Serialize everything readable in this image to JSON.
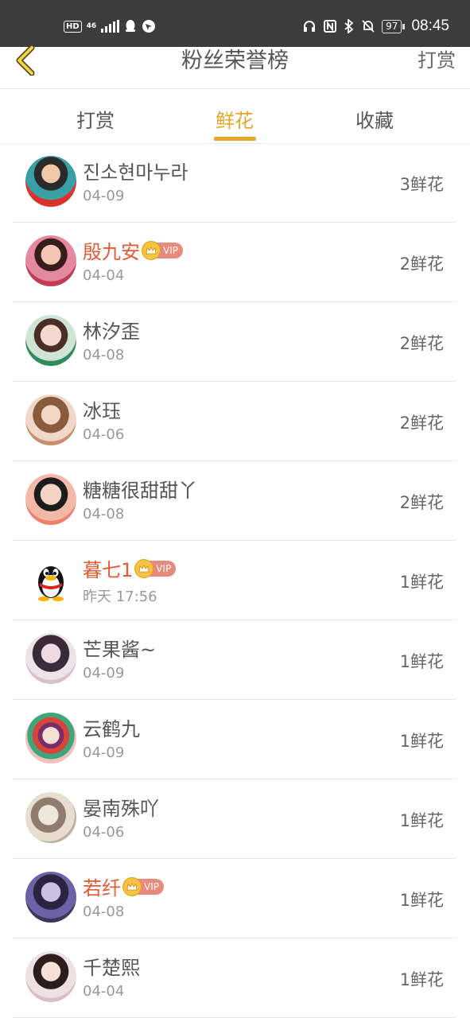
{
  "status_bar": {
    "hd": "HD",
    "network": "46",
    "battery": "97",
    "time": "08:45"
  },
  "header": {
    "title": "粉丝荣誉榜",
    "action": "打赏"
  },
  "tabs": [
    {
      "label": "打赏",
      "active": false
    },
    {
      "label": "鲜花",
      "active": true
    },
    {
      "label": "收藏",
      "active": false
    }
  ],
  "accent_color": "#e9a42c",
  "vip_name_color": "#e25b34",
  "vip_label": "VIP",
  "fans": [
    {
      "name": "진소현마누라",
      "date": "04-09",
      "amount": "3鲜花",
      "vip": false
    },
    {
      "name": "殷九安",
      "date": "04-04",
      "amount": "2鲜花",
      "vip": true
    },
    {
      "name": "林汐歪",
      "date": "04-08",
      "amount": "2鲜花",
      "vip": false
    },
    {
      "name": "冰珏",
      "date": "04-06",
      "amount": "2鲜花",
      "vip": false
    },
    {
      "name": "糖糖很甜甜丫",
      "date": "04-08",
      "amount": "2鲜花",
      "vip": false
    },
    {
      "name": "暮七1",
      "date": "昨天 17:56",
      "amount": "1鲜花",
      "vip": true
    },
    {
      "name": "芒果酱~",
      "date": "04-09",
      "amount": "1鲜花",
      "vip": false
    },
    {
      "name": "云鹤九",
      "date": "04-09",
      "amount": "1鲜花",
      "vip": false
    },
    {
      "name": "晏南殊吖",
      "date": "04-06",
      "amount": "1鲜花",
      "vip": false
    },
    {
      "name": "若纤",
      "date": "04-08",
      "amount": "1鲜花",
      "vip": true
    },
    {
      "name": "千楚熙",
      "date": "04-04",
      "amount": "1鲜花",
      "vip": false
    }
  ]
}
